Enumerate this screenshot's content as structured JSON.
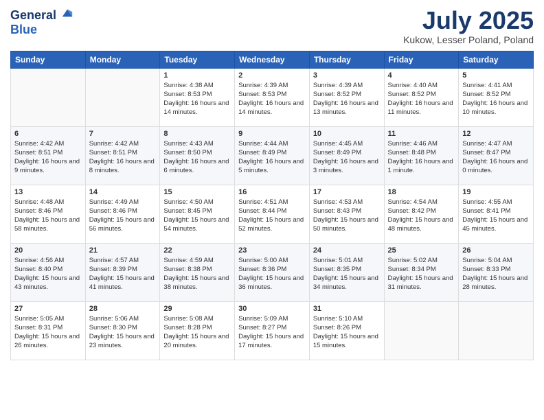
{
  "header": {
    "logo_line1": "General",
    "logo_line2": "Blue",
    "month": "July 2025",
    "location": "Kukow, Lesser Poland, Poland"
  },
  "weekdays": [
    "Sunday",
    "Monday",
    "Tuesday",
    "Wednesday",
    "Thursday",
    "Friday",
    "Saturday"
  ],
  "weeks": [
    [
      {
        "day": "",
        "sunrise": "",
        "sunset": "",
        "daylight": ""
      },
      {
        "day": "",
        "sunrise": "",
        "sunset": "",
        "daylight": ""
      },
      {
        "day": "1",
        "sunrise": "Sunrise: 4:38 AM",
        "sunset": "Sunset: 8:53 PM",
        "daylight": "Daylight: 16 hours and 14 minutes."
      },
      {
        "day": "2",
        "sunrise": "Sunrise: 4:39 AM",
        "sunset": "Sunset: 8:53 PM",
        "daylight": "Daylight: 16 hours and 14 minutes."
      },
      {
        "day": "3",
        "sunrise": "Sunrise: 4:39 AM",
        "sunset": "Sunset: 8:52 PM",
        "daylight": "Daylight: 16 hours and 13 minutes."
      },
      {
        "day": "4",
        "sunrise": "Sunrise: 4:40 AM",
        "sunset": "Sunset: 8:52 PM",
        "daylight": "Daylight: 16 hours and 11 minutes."
      },
      {
        "day": "5",
        "sunrise": "Sunrise: 4:41 AM",
        "sunset": "Sunset: 8:52 PM",
        "daylight": "Daylight: 16 hours and 10 minutes."
      }
    ],
    [
      {
        "day": "6",
        "sunrise": "Sunrise: 4:42 AM",
        "sunset": "Sunset: 8:51 PM",
        "daylight": "Daylight: 16 hours and 9 minutes."
      },
      {
        "day": "7",
        "sunrise": "Sunrise: 4:42 AM",
        "sunset": "Sunset: 8:51 PM",
        "daylight": "Daylight: 16 hours and 8 minutes."
      },
      {
        "day": "8",
        "sunrise": "Sunrise: 4:43 AM",
        "sunset": "Sunset: 8:50 PM",
        "daylight": "Daylight: 16 hours and 6 minutes."
      },
      {
        "day": "9",
        "sunrise": "Sunrise: 4:44 AM",
        "sunset": "Sunset: 8:49 PM",
        "daylight": "Daylight: 16 hours and 5 minutes."
      },
      {
        "day": "10",
        "sunrise": "Sunrise: 4:45 AM",
        "sunset": "Sunset: 8:49 PM",
        "daylight": "Daylight: 16 hours and 3 minutes."
      },
      {
        "day": "11",
        "sunrise": "Sunrise: 4:46 AM",
        "sunset": "Sunset: 8:48 PM",
        "daylight": "Daylight: 16 hours and 1 minute."
      },
      {
        "day": "12",
        "sunrise": "Sunrise: 4:47 AM",
        "sunset": "Sunset: 8:47 PM",
        "daylight": "Daylight: 16 hours and 0 minutes."
      }
    ],
    [
      {
        "day": "13",
        "sunrise": "Sunrise: 4:48 AM",
        "sunset": "Sunset: 8:46 PM",
        "daylight": "Daylight: 15 hours and 58 minutes."
      },
      {
        "day": "14",
        "sunrise": "Sunrise: 4:49 AM",
        "sunset": "Sunset: 8:46 PM",
        "daylight": "Daylight: 15 hours and 56 minutes."
      },
      {
        "day": "15",
        "sunrise": "Sunrise: 4:50 AM",
        "sunset": "Sunset: 8:45 PM",
        "daylight": "Daylight: 15 hours and 54 minutes."
      },
      {
        "day": "16",
        "sunrise": "Sunrise: 4:51 AM",
        "sunset": "Sunset: 8:44 PM",
        "daylight": "Daylight: 15 hours and 52 minutes."
      },
      {
        "day": "17",
        "sunrise": "Sunrise: 4:53 AM",
        "sunset": "Sunset: 8:43 PM",
        "daylight": "Daylight: 15 hours and 50 minutes."
      },
      {
        "day": "18",
        "sunrise": "Sunrise: 4:54 AM",
        "sunset": "Sunset: 8:42 PM",
        "daylight": "Daylight: 15 hours and 48 minutes."
      },
      {
        "day": "19",
        "sunrise": "Sunrise: 4:55 AM",
        "sunset": "Sunset: 8:41 PM",
        "daylight": "Daylight: 15 hours and 45 minutes."
      }
    ],
    [
      {
        "day": "20",
        "sunrise": "Sunrise: 4:56 AM",
        "sunset": "Sunset: 8:40 PM",
        "daylight": "Daylight: 15 hours and 43 minutes."
      },
      {
        "day": "21",
        "sunrise": "Sunrise: 4:57 AM",
        "sunset": "Sunset: 8:39 PM",
        "daylight": "Daylight: 15 hours and 41 minutes."
      },
      {
        "day": "22",
        "sunrise": "Sunrise: 4:59 AM",
        "sunset": "Sunset: 8:38 PM",
        "daylight": "Daylight: 15 hours and 38 minutes."
      },
      {
        "day": "23",
        "sunrise": "Sunrise: 5:00 AM",
        "sunset": "Sunset: 8:36 PM",
        "daylight": "Daylight: 15 hours and 36 minutes."
      },
      {
        "day": "24",
        "sunrise": "Sunrise: 5:01 AM",
        "sunset": "Sunset: 8:35 PM",
        "daylight": "Daylight: 15 hours and 34 minutes."
      },
      {
        "day": "25",
        "sunrise": "Sunrise: 5:02 AM",
        "sunset": "Sunset: 8:34 PM",
        "daylight": "Daylight: 15 hours and 31 minutes."
      },
      {
        "day": "26",
        "sunrise": "Sunrise: 5:04 AM",
        "sunset": "Sunset: 8:33 PM",
        "daylight": "Daylight: 15 hours and 28 minutes."
      }
    ],
    [
      {
        "day": "27",
        "sunrise": "Sunrise: 5:05 AM",
        "sunset": "Sunset: 8:31 PM",
        "daylight": "Daylight: 15 hours and 26 minutes."
      },
      {
        "day": "28",
        "sunrise": "Sunrise: 5:06 AM",
        "sunset": "Sunset: 8:30 PM",
        "daylight": "Daylight: 15 hours and 23 minutes."
      },
      {
        "day": "29",
        "sunrise": "Sunrise: 5:08 AM",
        "sunset": "Sunset: 8:28 PM",
        "daylight": "Daylight: 15 hours and 20 minutes."
      },
      {
        "day": "30",
        "sunrise": "Sunrise: 5:09 AM",
        "sunset": "Sunset: 8:27 PM",
        "daylight": "Daylight: 15 hours and 17 minutes."
      },
      {
        "day": "31",
        "sunrise": "Sunrise: 5:10 AM",
        "sunset": "Sunset: 8:26 PM",
        "daylight": "Daylight: 15 hours and 15 minutes."
      },
      {
        "day": "",
        "sunrise": "",
        "sunset": "",
        "daylight": ""
      },
      {
        "day": "",
        "sunrise": "",
        "sunset": "",
        "daylight": ""
      }
    ]
  ]
}
